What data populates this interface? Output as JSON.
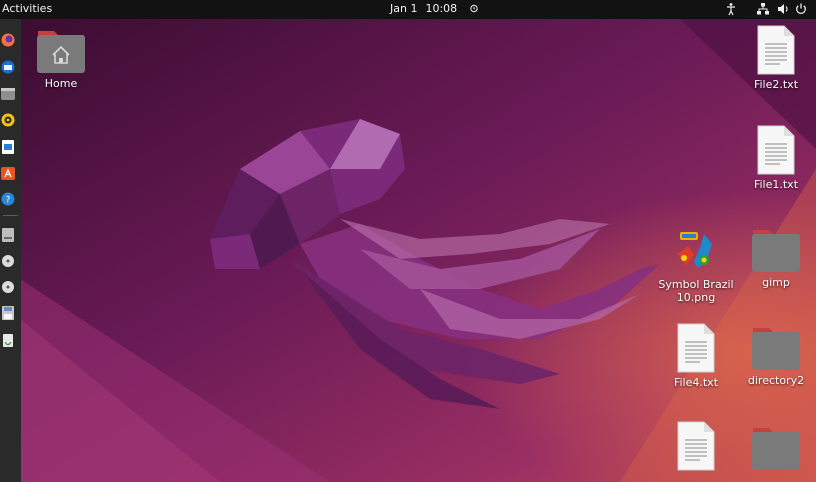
{
  "topbar": {
    "activities": "Activities",
    "date": "Jan 1",
    "time": "10:08"
  },
  "dock": {
    "items": [
      {
        "icon": "firefox-icon"
      },
      {
        "icon": "thunderbird-icon"
      },
      {
        "icon": "files-icon"
      },
      {
        "icon": "rhythmbox-icon"
      },
      {
        "icon": "libreoffice-writer-icon"
      },
      {
        "icon": "software-center-icon"
      },
      {
        "icon": "help-icon"
      },
      {
        "icon": "disk-drive-icon"
      },
      {
        "icon": "optical-disc-icon"
      },
      {
        "icon": "optical-disc-icon"
      },
      {
        "icon": "floppy-save-icon"
      },
      {
        "icon": "trash-icon"
      }
    ]
  },
  "desktop": {
    "home": "Home",
    "file2": "File2.txt",
    "file1": "File1.txt",
    "symbol_line1": "Symbol Brazil",
    "symbol_line2": "10.png",
    "gimp": "gimp",
    "file4": "File4.txt",
    "directory2": "directory2"
  },
  "colors": {
    "folder": "#7a7a7a",
    "folder_tab": "#c34141",
    "wallpaper_dark": "#3b0b33",
    "wallpaper_mid": "#8a2a6e",
    "wallpaper_light": "#c8504a"
  }
}
